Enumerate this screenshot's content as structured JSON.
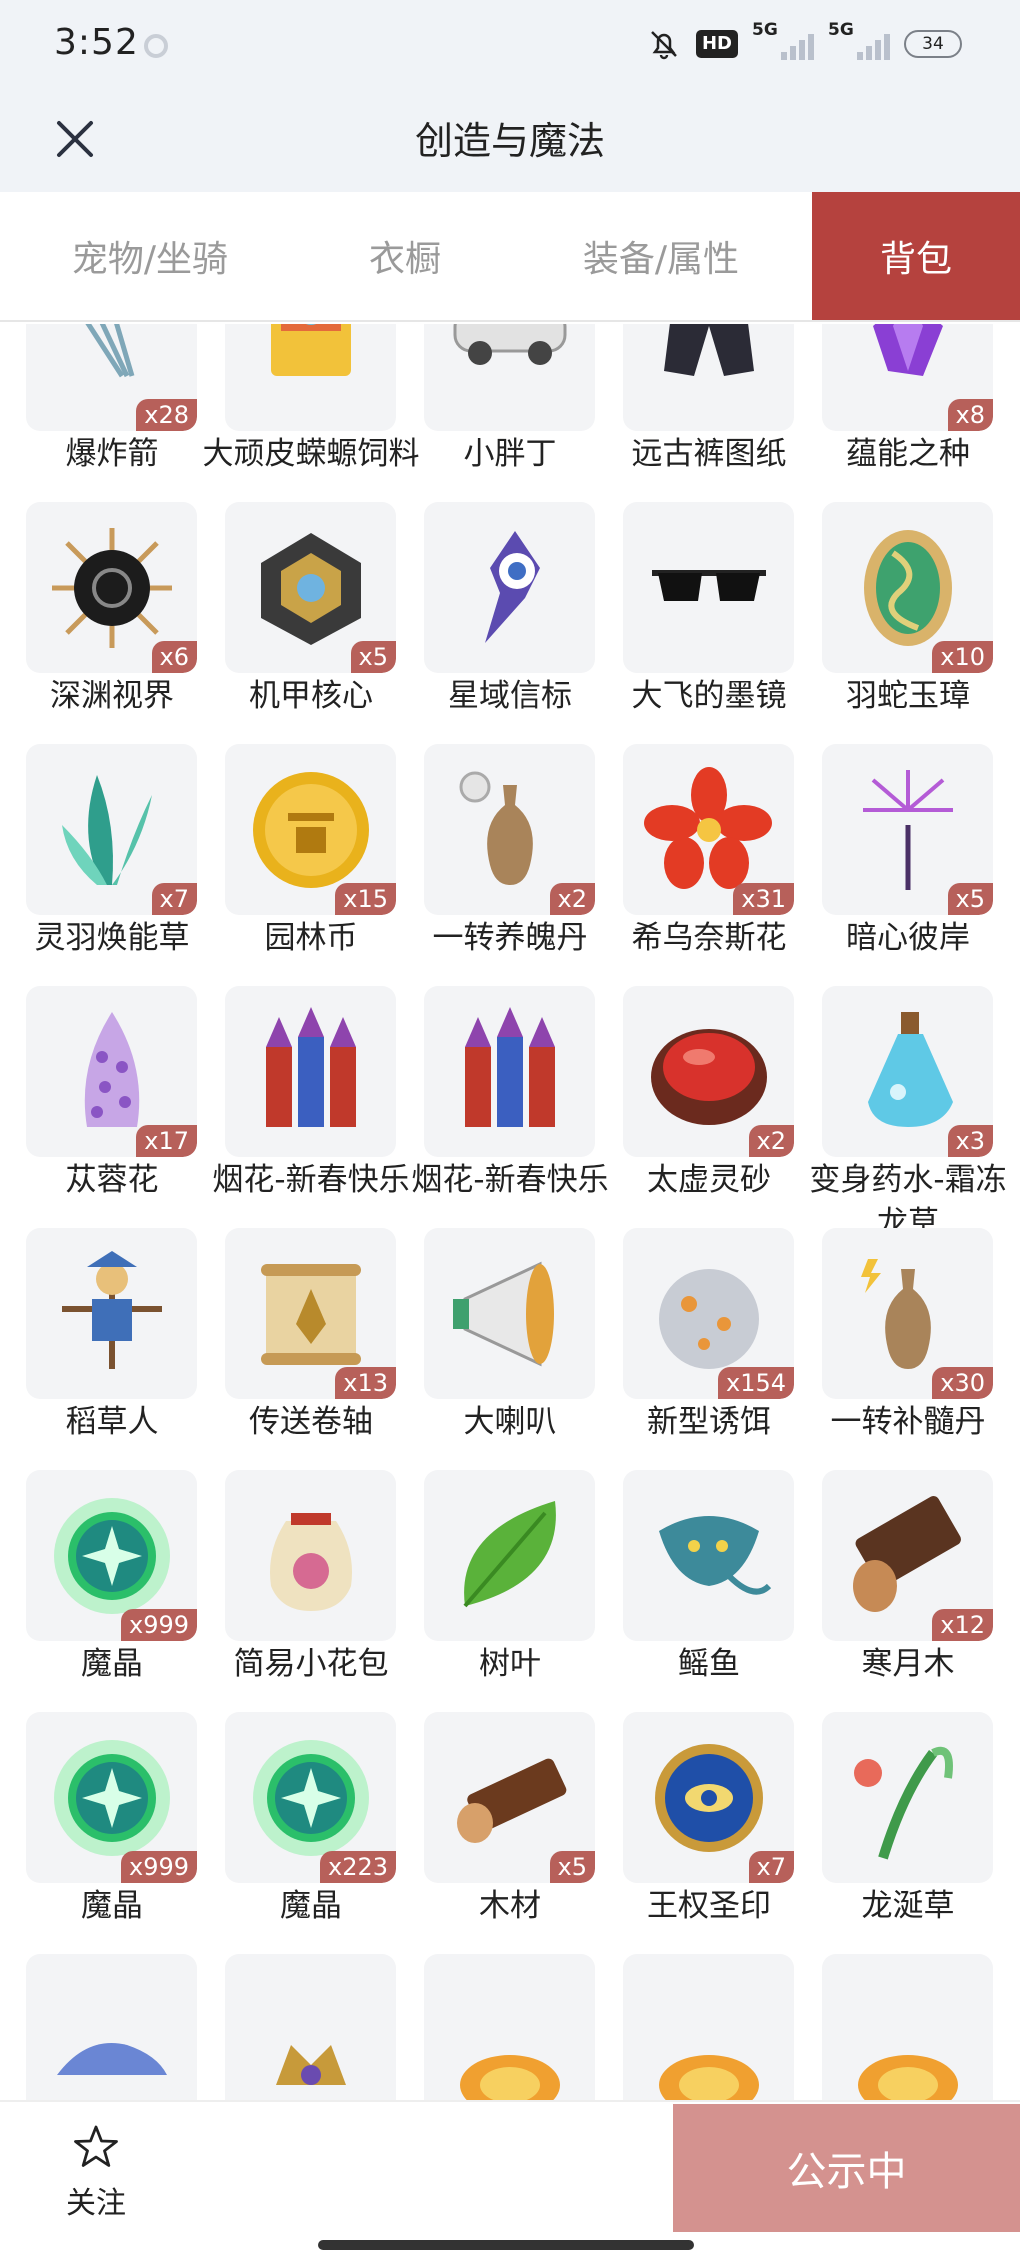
{
  "status": {
    "time": "3:52",
    "hd": "HD",
    "net1": "5G",
    "net2": "5G",
    "battery": "34"
  },
  "header": {
    "title": "创造与魔法"
  },
  "tabs": [
    {
      "label": "宠物/坐骑",
      "active": false
    },
    {
      "label": "衣橱",
      "active": false
    },
    {
      "label": "装备/属性",
      "active": false
    },
    {
      "label": "背包",
      "active": true
    }
  ],
  "items": [
    {
      "name": "爆炸箭",
      "qty": "x28",
      "icon": "arrows-icon"
    },
    {
      "name": "大顽皮蝾螈饲料",
      "qty": "",
      "icon": "feed-box-icon"
    },
    {
      "name": "小胖丁",
      "qty": "",
      "icon": "car-icon"
    },
    {
      "name": "远古裤图纸",
      "qty": "",
      "icon": "pants-blueprint-icon"
    },
    {
      "name": "蕴能之种",
      "qty": "x8",
      "icon": "purple-crystal-icon"
    },
    {
      "name": "深渊视界",
      "qty": "x6",
      "icon": "abyss-eye-icon"
    },
    {
      "name": "机甲核心",
      "qty": "x5",
      "icon": "mech-core-icon"
    },
    {
      "name": "星域信标",
      "qty": "",
      "icon": "star-beacon-icon"
    },
    {
      "name": "大飞的墨镜",
      "qty": "",
      "icon": "sunglasses-icon"
    },
    {
      "name": "羽蛇玉璋",
      "qty": "x10",
      "icon": "serpent-jade-icon"
    },
    {
      "name": "灵羽焕能草",
      "qty": "x7",
      "icon": "feather-grass-icon"
    },
    {
      "name": "园林币",
      "qty": "x15",
      "icon": "gold-coin-icon"
    },
    {
      "name": "一转养魄丹",
      "qty": "x2",
      "icon": "vase-clock-icon"
    },
    {
      "name": "希乌奈斯花",
      "qty": "x31",
      "icon": "red-flower-icon"
    },
    {
      "name": "暗心彼岸",
      "qty": "x5",
      "icon": "spider-lily-icon"
    },
    {
      "name": "苁蓉花",
      "qty": "x17",
      "icon": "purple-cone-flower-icon"
    },
    {
      "name": "烟花-新春快乐",
      "qty": "",
      "icon": "firework-rockets-icon"
    },
    {
      "name": "烟花-新春快乐",
      "qty": "",
      "icon": "firework-rockets-icon"
    },
    {
      "name": "太虚灵砂",
      "qty": "x2",
      "icon": "red-sand-bowl-icon"
    },
    {
      "name": "变身药水-霜冻龙草",
      "qty": "x3",
      "icon": "potion-bottle-icon"
    },
    {
      "name": "稻草人",
      "qty": "",
      "icon": "scarecrow-icon"
    },
    {
      "name": "传送卷轴",
      "qty": "x13",
      "icon": "scroll-icon"
    },
    {
      "name": "大喇叭",
      "qty": "",
      "icon": "megaphone-icon"
    },
    {
      "name": "新型诱饵",
      "qty": "x154",
      "icon": "bait-ball-icon"
    },
    {
      "name": "一转补髓丹",
      "qty": "x30",
      "icon": "vase-lightning-icon"
    },
    {
      "name": "魔晶",
      "qty": "x999",
      "icon": "green-crystal-icon"
    },
    {
      "name": "简易小花包",
      "qty": "",
      "icon": "flower-bag-icon"
    },
    {
      "name": "树叶",
      "qty": "",
      "icon": "leaf-icon"
    },
    {
      "name": "鳐鱼",
      "qty": "",
      "icon": "stingray-icon"
    },
    {
      "name": "寒月木",
      "qty": "x12",
      "icon": "dark-log-icon"
    },
    {
      "name": "魔晶",
      "qty": "x999",
      "icon": "green-crystal-icon"
    },
    {
      "name": "魔晶",
      "qty": "x223",
      "icon": "green-crystal-icon"
    },
    {
      "name": "木材",
      "qty": "x5",
      "icon": "wood-log-icon"
    },
    {
      "name": "王权圣印",
      "qty": "x7",
      "icon": "royal-seal-icon"
    },
    {
      "name": "龙涎草",
      "qty": "",
      "icon": "dragon-grass-icon"
    },
    {
      "name": "",
      "qty": "",
      "icon": "blue-creature-icon"
    },
    {
      "name": "",
      "qty": "",
      "icon": "crown-beast-icon"
    },
    {
      "name": "",
      "qty": "",
      "icon": "fire-orb-icon"
    },
    {
      "name": "",
      "qty": "",
      "icon": "fire-orb-icon"
    },
    {
      "name": "",
      "qty": "",
      "icon": "fire-orb-icon"
    }
  ],
  "bottom": {
    "follow_label": "关注",
    "public_label": "公示中"
  },
  "colors": {
    "accent": "#b5423e",
    "badge": "#b7605a",
    "public_button": "#d4928f"
  }
}
